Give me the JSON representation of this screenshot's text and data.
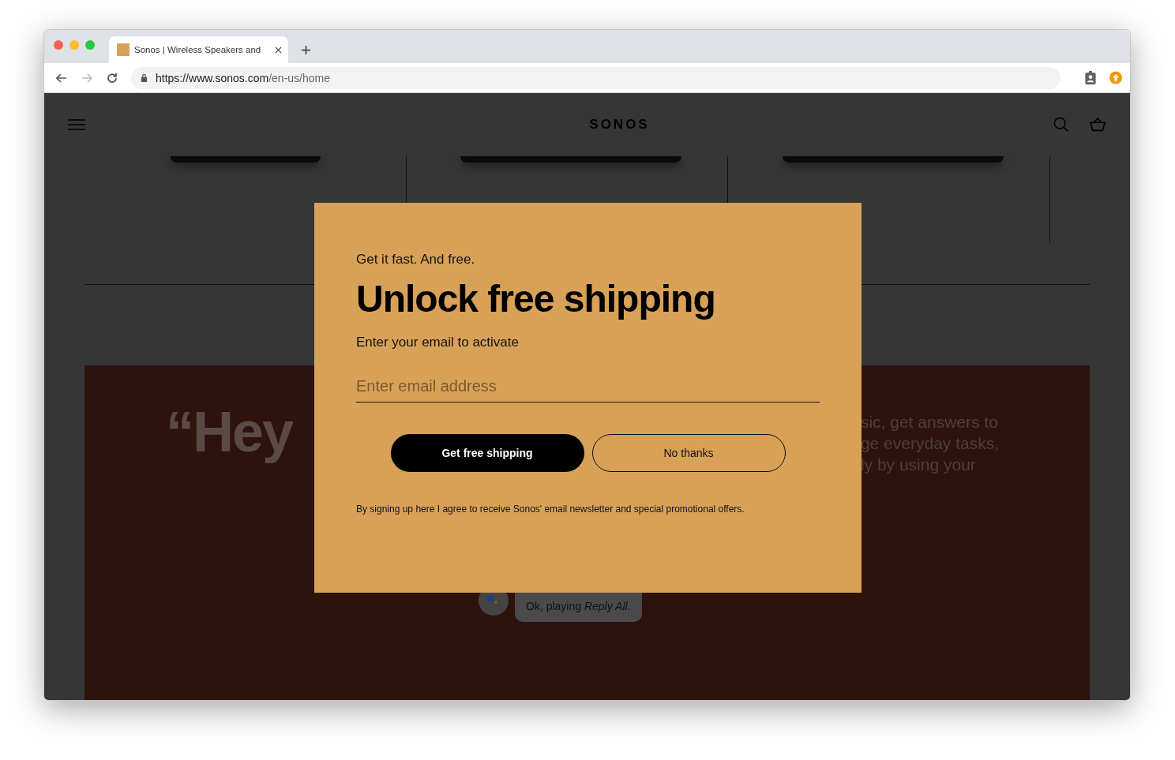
{
  "browser": {
    "tab_title": "Sonos | Wireless Speakers and",
    "url_host": "https://www.sonos.com",
    "url_path": "/en-us/home"
  },
  "site": {
    "logo": "SONOS"
  },
  "hero": {
    "quote": "“Hey",
    "text_lines": [
      "sic, get answers to",
      "ge everyday tasks,",
      "ly by using your"
    ],
    "assistant_reply": {
      "text": "Ok, playing *Reply All.*"
    }
  },
  "modal": {
    "eyebrow": "Get it fast. And free.",
    "title": "Unlock free shipping",
    "subtitle": "Enter your email to activate",
    "email": {
      "placeholder": "Enter email address"
    },
    "buttons": [
      {
        "label": "Get free shipping",
        "kind": "primary"
      },
      {
        "label": "No thanks",
        "kind": "secondary"
      }
    ],
    "disclaimer": "By signing up here I agree to receive Sonos' email newsletter and special promotional offers."
  }
}
